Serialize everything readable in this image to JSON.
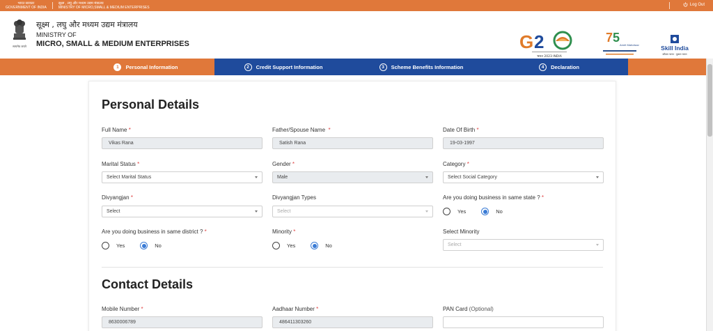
{
  "topbar": {
    "gov_hi": "भारत सरकार",
    "gov_en": "GOVERNMENT OF INDIA",
    "ministry_hi": "सूक्ष्म , लघु और मध्यम उद्यम मंत्रालय",
    "ministry_en": "MINISTRY OF MICRO,SMALL & MEDIUM ENTERPRISES",
    "logout": "Log Out"
  },
  "header": {
    "ministry_hi": "सूक्ष्म , लघु और मध्यम उद्यम मंत्रालय",
    "ministry_of": "MINISTRY OF",
    "ministry_name": "MICRO, SMALL & MEDIUM ENTERPRISES",
    "emblem_caption": "सत्यमेव जयते",
    "g20_text": "G20",
    "g20_sub": "भारत 2023 INDIA",
    "azadi_sub": "Amrit Mahotsav",
    "skill_text": "Skill India",
    "skill_sub": "कौशल भारत · कुशल भारत"
  },
  "steps": [
    {
      "num": "1",
      "label": "Personal Information",
      "active": true
    },
    {
      "num": "2",
      "label": "Credit Support Information",
      "active": false
    },
    {
      "num": "3",
      "label": "Scheme Benefits Information",
      "active": false
    },
    {
      "num": "4",
      "label": "Declaration",
      "active": false
    }
  ],
  "colors": {
    "orange": "#e0783a",
    "navy": "#1f4b9c",
    "radio_blue": "#3a7bd5"
  },
  "personal": {
    "title": "Personal Details",
    "full_name_label": "Full Name",
    "full_name_value": "Vikas Rana",
    "father_label": "Father/Spouse Name",
    "father_value": "Satish Rana",
    "dob_label": "Date Of Birth",
    "dob_value": "19-03-1997",
    "marital_label": "Marital Status",
    "marital_value": "Select Marital Status",
    "gender_label": "Gender",
    "gender_value": "Male",
    "category_label": "Category",
    "category_value": "Select Social Category",
    "divyangjan_label": "Divyangjan",
    "divyangjan_value": "Select",
    "divyangjan_types_label": "Divyangjan Types",
    "divyangjan_types_value": "Select",
    "same_state_label": "Are you doing business in same state ?",
    "same_district_label": "Are you doing business in same district ?",
    "minority_label": "Minority",
    "select_minority_label": "Select Minority",
    "select_minority_value": "Select",
    "yes": "Yes",
    "no": "No",
    "required_mark": "*"
  },
  "contact": {
    "title": "Contact Details",
    "mobile_label": "Mobile Number",
    "mobile_value": "8630006789",
    "aadhaar_label": "Aadhaar Number",
    "aadhaar_value": "486411303260",
    "pan_label": "PAN Card",
    "pan_optional": "(Optional)",
    "pan_value": ""
  }
}
